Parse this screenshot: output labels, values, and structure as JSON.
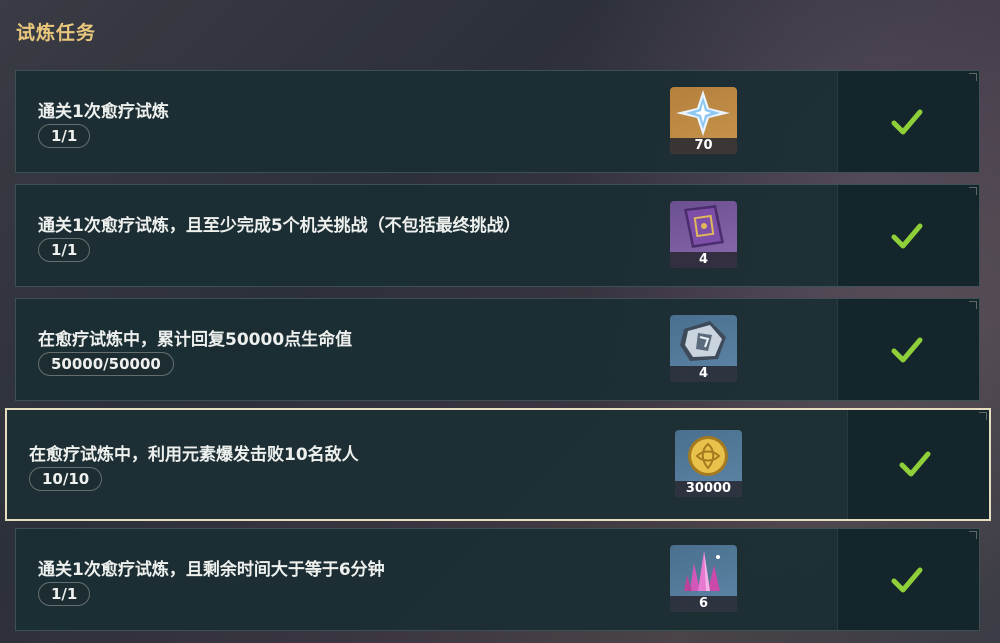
{
  "header": {
    "title": "试炼任务"
  },
  "tasks": [
    {
      "description": "通关1次愈疗试炼",
      "progress": "1/1",
      "reward": {
        "icon": "primogem-icon",
        "quantity": "70"
      },
      "completed": true
    },
    {
      "description": "通关1次愈疗试炼，且至少完成5个机关挑战（不包括最终挑战）",
      "progress": "1/1",
      "reward": {
        "icon": "heros-wit-book-icon",
        "quantity": "4"
      },
      "completed": true
    },
    {
      "description": "在愈疗试炼中，累计回复50000点生命值",
      "progress": "50000/50000",
      "reward": {
        "icon": "weapon-ore-icon",
        "quantity": "4"
      },
      "completed": true
    },
    {
      "description": "在愈疗试炼中，利用元素爆发击败10名敌人",
      "progress": "10/10",
      "reward": {
        "icon": "mora-coin-icon",
        "quantity": "30000"
      },
      "completed": true,
      "selected": true
    },
    {
      "description": "通关1次愈疗试炼，且剩余时间大于等于6分钟",
      "progress": "1/1",
      "reward": {
        "icon": "crystal-ore-icon",
        "quantity": "6"
      },
      "completed": true
    }
  ],
  "colors": {
    "title": "#e9c77c",
    "check": "#8fd03a",
    "selected_border": "#e6dcc0"
  }
}
